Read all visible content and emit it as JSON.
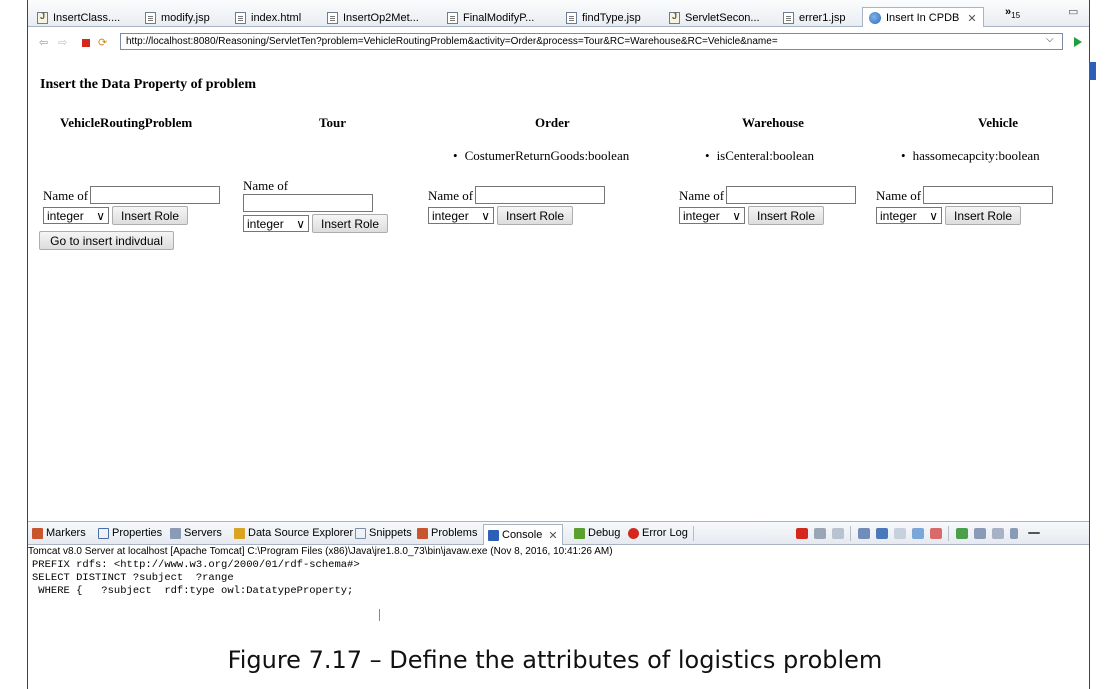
{
  "editor_tabs": [
    {
      "label": "InsertClass....",
      "kind": "java"
    },
    {
      "label": "modify.jsp",
      "kind": "file"
    },
    {
      "label": "index.html",
      "kind": "file"
    },
    {
      "label": "InsertOp2Met...",
      "kind": "file"
    },
    {
      "label": "FinalModifyP...",
      "kind": "file"
    },
    {
      "label": "findType.jsp",
      "kind": "file"
    },
    {
      "label": "ServletSecon...",
      "kind": "java"
    },
    {
      "label": "errer1.jsp",
      "kind": "file"
    },
    {
      "label": "Insert In CPDB",
      "kind": "browser",
      "active": true
    }
  ],
  "tab_close": "✕",
  "tab_overflow": {
    "symbol": "»",
    "count": "15"
  },
  "browser": {
    "url": "http://localhost:8080/Reasoning/ServletTen?problem=VehicleRoutingProblem&activity=Order&process=Tour&RC=Warehouse&RC=Vehicle&name="
  },
  "page": {
    "heading": "Insert the Data Property of problem",
    "columns": [
      {
        "title": "VehicleRoutingProblem",
        "property": "",
        "name_label": "Name of",
        "type_value": "integer",
        "button": "Insert Role"
      },
      {
        "title": "Tour",
        "property": "",
        "name_label": "Name of",
        "type_value": "integer",
        "button": "Insert Role"
      },
      {
        "title": "Order",
        "property": "CostumerReturnGoods:boolean",
        "name_label": "Name of",
        "type_value": "integer",
        "button": "Insert Role"
      },
      {
        "title": "Warehouse",
        "property": "isCenteral:boolean",
        "name_label": "Name of",
        "type_value": "integer",
        "button": "Insert Role"
      },
      {
        "title": "Vehicle",
        "property": "hassomecapcity:boolean",
        "name_label": "Name of",
        "type_value": "integer",
        "button": "Insert Role"
      }
    ],
    "go_button": "Go to insert indivdual"
  },
  "views": {
    "tabs": [
      "Markers",
      "Properties",
      "Servers",
      "Data Source Explorer",
      "Snippets",
      "Problems",
      "Console",
      "Debug",
      "Error Log"
    ],
    "active": "Console"
  },
  "console": {
    "title": "Tomcat v8.0 Server at localhost [Apache Tomcat] C:\\Program Files (x86)\\Java\\jre1.8.0_73\\bin\\javaw.exe (Nov 8, 2016, 10:41:26 AM)",
    "lines": [
      "PREFIX rdfs: <http://www.w3.org/2000/01/rdf-schema#>",
      "SELECT DISTINCT ?subject  ?range",
      " WHERE {   ?subject  rdf:type owl:DatatypeProperty;"
    ]
  },
  "caption": "Figure 7.17 – Define the attributes of logistics problem"
}
